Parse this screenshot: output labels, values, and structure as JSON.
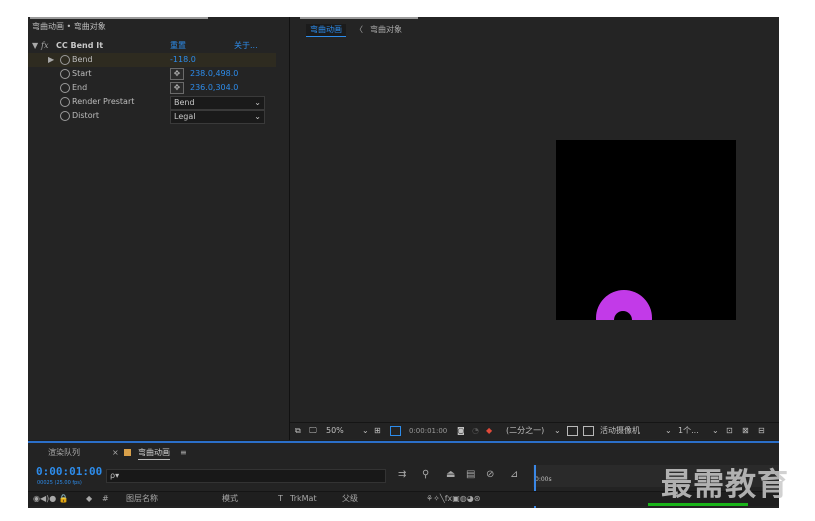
{
  "effect_controls": {
    "header": "弯曲动画 • 弯曲对象",
    "effect_name": "CC Bend It",
    "fx_label": "fx",
    "reset_label": "重置",
    "about_label": "关于...",
    "props": [
      {
        "name": "Bend",
        "value": "-118.0"
      },
      {
        "name": "Start",
        "value": "238.0,498.0"
      },
      {
        "name": "End",
        "value": "236.0,304.0"
      },
      {
        "name": "Render Prestart",
        "value": "Bend"
      },
      {
        "name": "Distort",
        "value": "Legal"
      }
    ]
  },
  "composition": {
    "tabs": [
      "弯曲动画",
      "弯曲对象"
    ],
    "shape_color": "#c23ae8",
    "toolbar": {
      "zoom": "50%",
      "timecode": "0:00:01:00",
      "resolution": "(二分之一)",
      "camera": "活动摄像机",
      "views": "1个..."
    }
  },
  "timeline": {
    "tabs": [
      "渲染队列",
      "弯曲动画"
    ],
    "current_time": "0:00:01:00",
    "fps": "00025 (25.00 fps)",
    "search_placeholder": "ρ▾",
    "ruler_start": "0:00s",
    "columns": {
      "hash": "#",
      "layer_name": "图层名称",
      "mode": "模式",
      "t": "T",
      "trkmat": "TrkMat",
      "parent": "父级"
    }
  },
  "watermark": "最需教育",
  "colors": {
    "accent": "#2d8ceb",
    "panel": "#242424",
    "timeline_border": "#2b6fc9"
  }
}
